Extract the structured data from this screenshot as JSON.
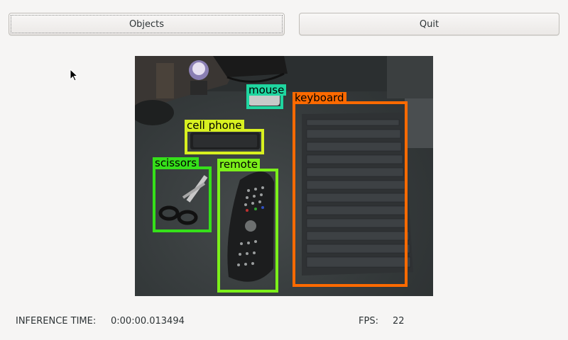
{
  "toolbar": {
    "objects_label": "Objects",
    "quit_label": "Quit"
  },
  "detections": [
    {
      "label": "mouse",
      "color": "#1fd6a0"
    },
    {
      "label": "keyboard",
      "color": "#ff6a00"
    },
    {
      "label": "cell phone",
      "color": "#d8f020"
    },
    {
      "label": "scissors",
      "color": "#35e01a"
    },
    {
      "label": "remote",
      "color": "#7cf01a"
    }
  ],
  "status": {
    "inference_label": "INFERENCE TIME:",
    "inference_value": "0:00:00.013494",
    "fps_label": "FPS:",
    "fps_value": "22"
  }
}
